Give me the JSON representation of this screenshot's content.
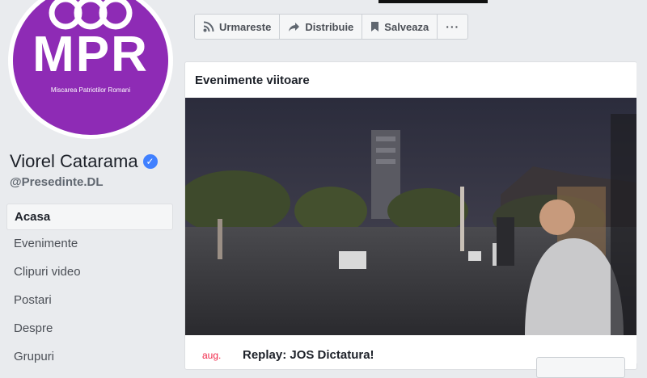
{
  "page": {
    "logo": {
      "main": "MPR",
      "subtitle": "Miscarea Patriotilor Romani"
    },
    "name": "Viorel Catarama",
    "handle": "@Presedinte.DL",
    "nav": [
      "Acasa",
      "Evenimente",
      "Clipuri video",
      "Postari",
      "Despre",
      "Grupuri"
    ]
  },
  "actions": {
    "follow": "Urmareste",
    "share": "Distribuie",
    "save": "Salveaza",
    "more": "···"
  },
  "events": {
    "title": "Evenimente viitoare",
    "item": {
      "month": "aug.",
      "title": "Replay: JOS Dictatura!"
    }
  },
  "colors": {
    "brand_purple": "#8e2bb5",
    "verified_blue": "#4080ff",
    "date_red": "#f02849"
  },
  "icons": [
    "rss-icon",
    "share-arrow-icon",
    "bookmark-icon",
    "verified-check-icon"
  ]
}
